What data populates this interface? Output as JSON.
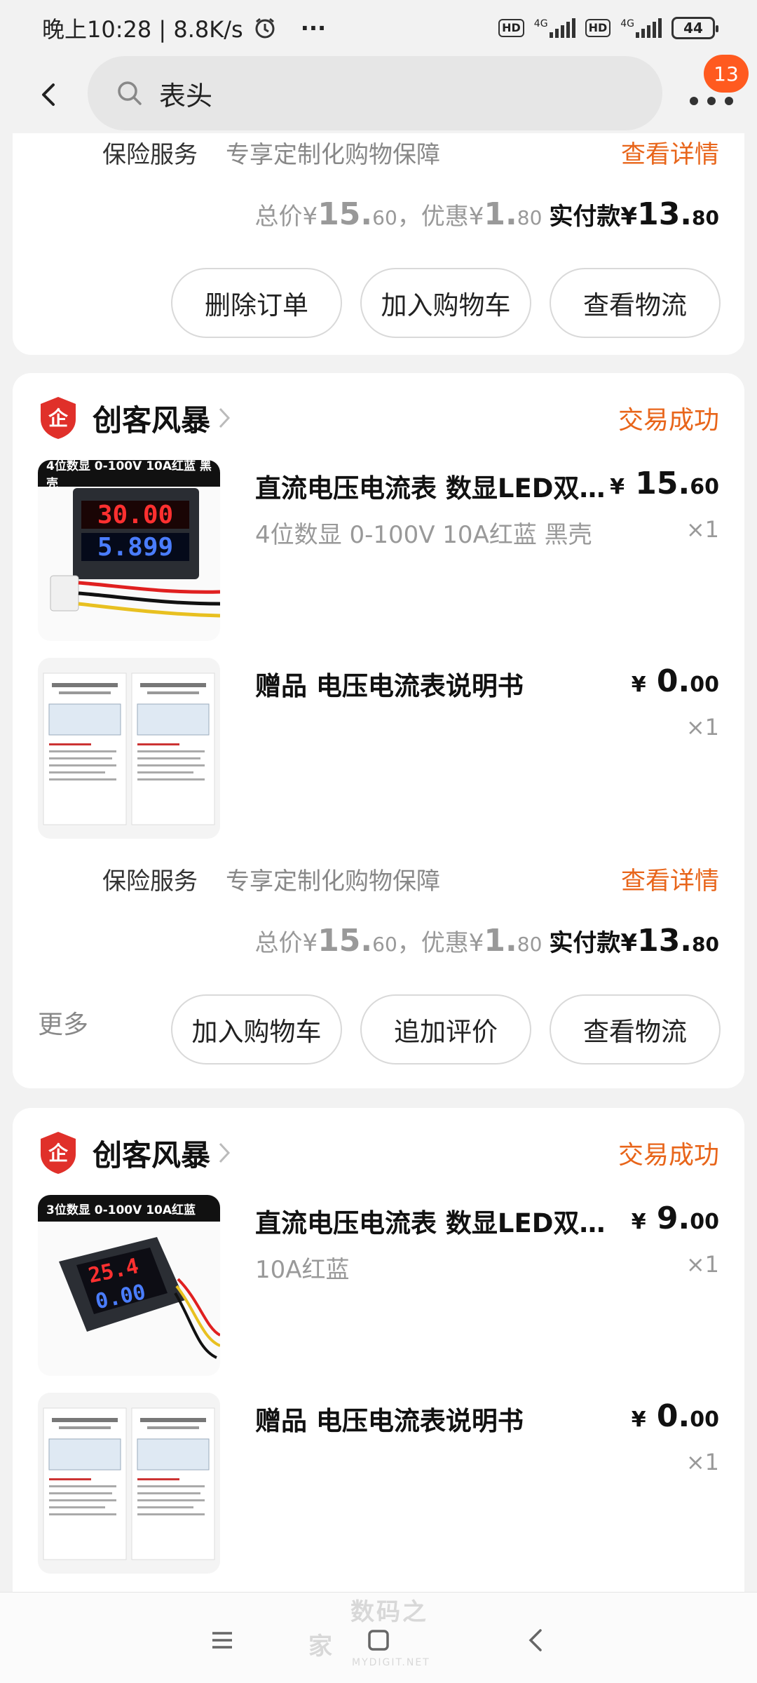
{
  "status_bar": {
    "time_speed": "晚上10:28 | 8.8K/s",
    "more": "···",
    "hd1": "HD",
    "hd2": "HD",
    "net": "4G",
    "battery": "44"
  },
  "top_bar": {
    "search_query": "表头",
    "badge_count": "13"
  },
  "card_partial": {
    "insurance_label": "保险服务",
    "insurance_desc": "专享定制化购物保障",
    "insurance_link": "查看详情",
    "total_prefix": "总价¥",
    "total_int": "15.",
    "total_dec": "60",
    "disc_prefix": "，优惠¥",
    "disc_int": "1.",
    "disc_dec": "80",
    "pay_prefix": "实付款¥",
    "pay_int": "13.",
    "pay_dec": "80",
    "buttons": [
      "删除订单",
      "加入购物车",
      "查看物流"
    ]
  },
  "orders": [
    {
      "shop_name": "创客风暴",
      "status": "交易成功",
      "items": [
        {
          "thumb_caption": "4位数显 0-100V 10A红蓝 黑壳",
          "title": "直流电压电流表  数显LED双显数字电压电流表头",
          "spec": "4位数显 0-100V 10A红蓝 黑壳",
          "price_int": "15.",
          "price_dec": "60",
          "qty": "×1"
        },
        {
          "thumb_caption": "",
          "title": "赠品  电压电流表说明书",
          "spec": "",
          "price_int": "0.",
          "price_dec": "00",
          "qty": "×1"
        }
      ],
      "insurance_label": "保险服务",
      "insurance_desc": "专享定制化购物保障",
      "insurance_link": "查看详情",
      "total_prefix": "总价¥",
      "total_int": "15.",
      "total_dec": "60",
      "disc_prefix": "，优惠¥",
      "disc_int": "1.",
      "disc_dec": "80",
      "pay_prefix": "实付款¥",
      "pay_int": "13.",
      "pay_dec": "80",
      "more": "更多",
      "buttons": [
        "加入购物车",
        "追加评价",
        "查看物流"
      ]
    },
    {
      "shop_name": "创客风暴",
      "status": "交易成功",
      "items": [
        {
          "thumb_caption": "3位数显 0-100V 10A红蓝",
          "title": "直流电压电流表  数显LED双显数字电压电流表头",
          "spec": "10A红蓝",
          "price_int": "9.",
          "price_dec": "00",
          "qty": "×1"
        },
        {
          "thumb_caption": "",
          "title": "赠品  电压电流表说明书",
          "spec": "",
          "price_int": "0.",
          "price_dec": "00",
          "qty": "×1"
        }
      ]
    }
  ],
  "yen": "¥",
  "watermark": {
    "text": "数码之家",
    "sub": "MYDIGIT.NET"
  }
}
